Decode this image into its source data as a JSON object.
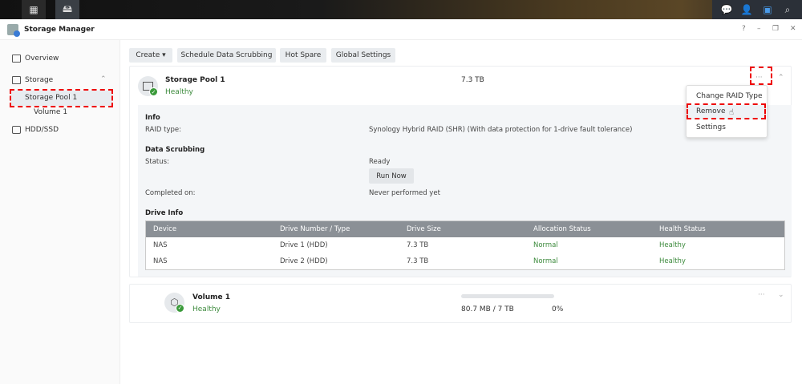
{
  "taskbar": {
    "icons": [
      "main-menu-icon",
      "storage-manager-icon",
      "chat-icon",
      "user-icon",
      "widgets-icon",
      "search-icon"
    ]
  },
  "window": {
    "title": "Storage Manager",
    "controls": [
      "?",
      "–",
      "❐",
      "✕"
    ]
  },
  "sidebar": {
    "overview": "Overview",
    "storage": "Storage",
    "storage_pool": "Storage Pool 1",
    "volume": "Volume 1",
    "hdd": "HDD/SSD"
  },
  "toolbar": {
    "create": "Create ▾",
    "schedule": "Schedule Data Scrubbing",
    "hot_spare": "Hot Spare",
    "global": "Global Settings"
  },
  "pool": {
    "name": "Storage Pool 1",
    "status": "Healthy",
    "size": "7.3 TB",
    "more": "···",
    "info_title": "Info",
    "raid_label": "RAID type:",
    "raid_value": "Synology Hybrid RAID (SHR) (With data protection for 1-drive fault tolerance)",
    "scrub_title": "Data Scrubbing",
    "status_label": "Status:",
    "status_value": "Ready",
    "run_now": "Run Now",
    "completed_label": "Completed on:",
    "completed_value": "Never performed yet",
    "drive_title": "Drive Info",
    "columns": [
      "Device",
      "Drive Number / Type",
      "Drive Size",
      "Allocation Status",
      "Health Status"
    ],
    "rows": [
      [
        "NAS",
        "Drive 1 (HDD)",
        "7.3 TB",
        "Normal",
        "Healthy"
      ],
      [
        "NAS",
        "Drive 2 (HDD)",
        "7.3 TB",
        "Normal",
        "Healthy"
      ]
    ]
  },
  "volume": {
    "name": "Volume 1",
    "status": "Healthy",
    "usage": "80.7 MB / 7 TB",
    "percent": "0%",
    "usage_fraction": 0,
    "more": "···"
  },
  "menu": {
    "items": [
      "Change RAID Type",
      "Remove",
      "Settings"
    ]
  },
  "colors": {
    "highlight": "#e00000",
    "healthy": "#3c8a3c"
  }
}
